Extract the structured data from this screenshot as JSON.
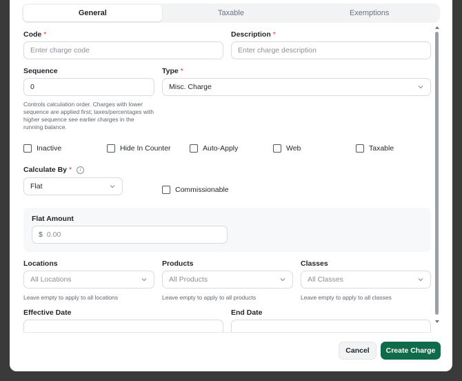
{
  "tabs": [
    {
      "label": "General",
      "active": true
    },
    {
      "label": "Taxable",
      "active": false
    },
    {
      "label": "Exemptions",
      "active": false
    }
  ],
  "fields": {
    "code": {
      "label": "Code",
      "required": "*",
      "placeholder": "Enter charge code"
    },
    "description": {
      "label": "Description",
      "required": "*",
      "placeholder": "Enter charge description"
    },
    "sequence": {
      "label": "Sequence",
      "value": "0",
      "help": "Controls calculation order. Charges with lower sequence are applied first; taxes/percentages with higher sequence see earlier charges in the running balance."
    },
    "type": {
      "label": "Type",
      "required": "*",
      "value": "Misc. Charge"
    },
    "calculate_by": {
      "label": "Calculate By",
      "required": "*",
      "value": "Flat"
    },
    "flat_amount": {
      "label": "Flat Amount",
      "prefix": "$",
      "placeholder": "0.00"
    },
    "locations": {
      "label": "Locations",
      "placeholder": "All Locations",
      "help": "Leave empty to apply to all locations"
    },
    "products": {
      "label": "Products",
      "placeholder": "All Products",
      "help": "Leave empty to apply to all products"
    },
    "classes": {
      "label": "Classes",
      "placeholder": "All Classes",
      "help": "Leave empty to apply to all classes"
    },
    "effective_date": {
      "label": "Effective Date"
    },
    "end_date": {
      "label": "End Date"
    }
  },
  "checkboxes": {
    "inactive": "Inactive",
    "hide_in_counter": "Hide In Counter",
    "auto_apply": "Auto-Apply",
    "web": "Web",
    "taxable": "Taxable",
    "commissionable": "Commissionable"
  },
  "info_icon_glyph": "i",
  "buttons": {
    "cancel": "Cancel",
    "create": "Create Charge"
  },
  "colors": {
    "primary": "#0f6b4a",
    "required": "#e03131"
  }
}
